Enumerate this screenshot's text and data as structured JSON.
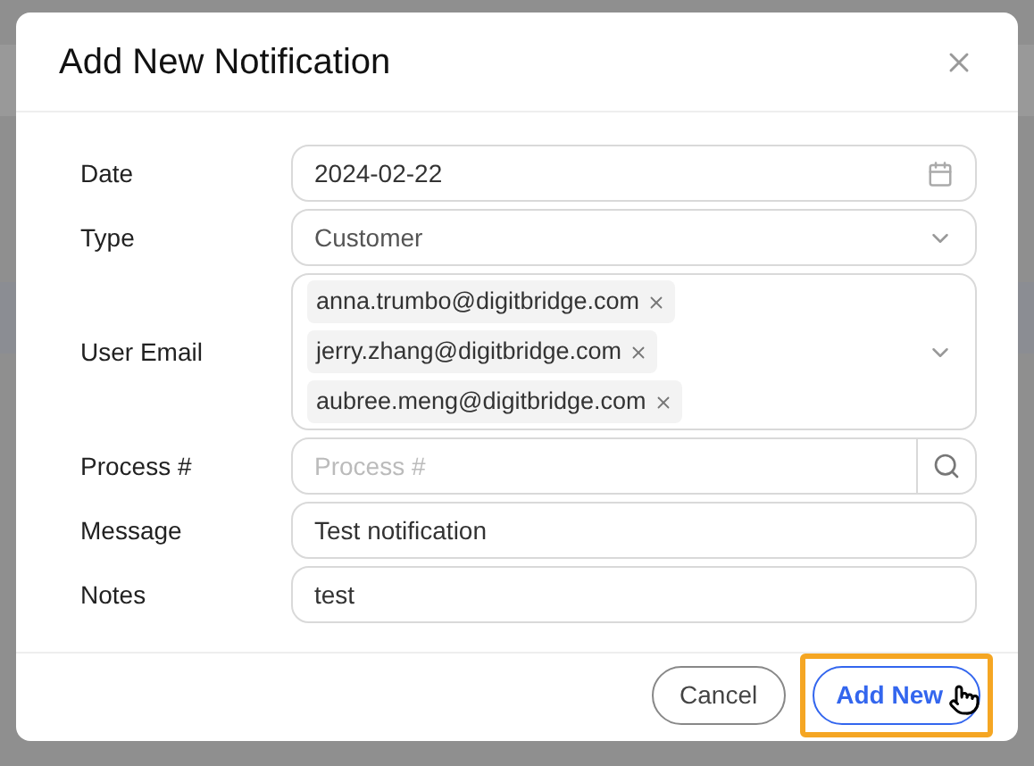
{
  "dialog": {
    "title": "Add New Notification"
  },
  "fields": [
    {
      "kind": "date",
      "label": "Date",
      "value": "2024-02-22"
    },
    {
      "kind": "select",
      "label": "Type",
      "value": "Customer"
    },
    {
      "kind": "tags",
      "label": "User Email",
      "tags": [
        "anna.trumbo@digitbridge.com",
        "jerry.zhang@digitbridge.com",
        "aubree.meng@digitbridge.com"
      ]
    },
    {
      "kind": "search",
      "label": "Process #",
      "placeholder": "Process #"
    },
    {
      "kind": "text",
      "label": "Message",
      "value": "Test notification"
    },
    {
      "kind": "text",
      "label": "Notes",
      "value": "test"
    }
  ],
  "buttons": [
    {
      "label": "Cancel",
      "kind": "secondary",
      "highlighted": false
    },
    {
      "label": "Add New",
      "kind": "primary",
      "highlighted": true
    }
  ]
}
